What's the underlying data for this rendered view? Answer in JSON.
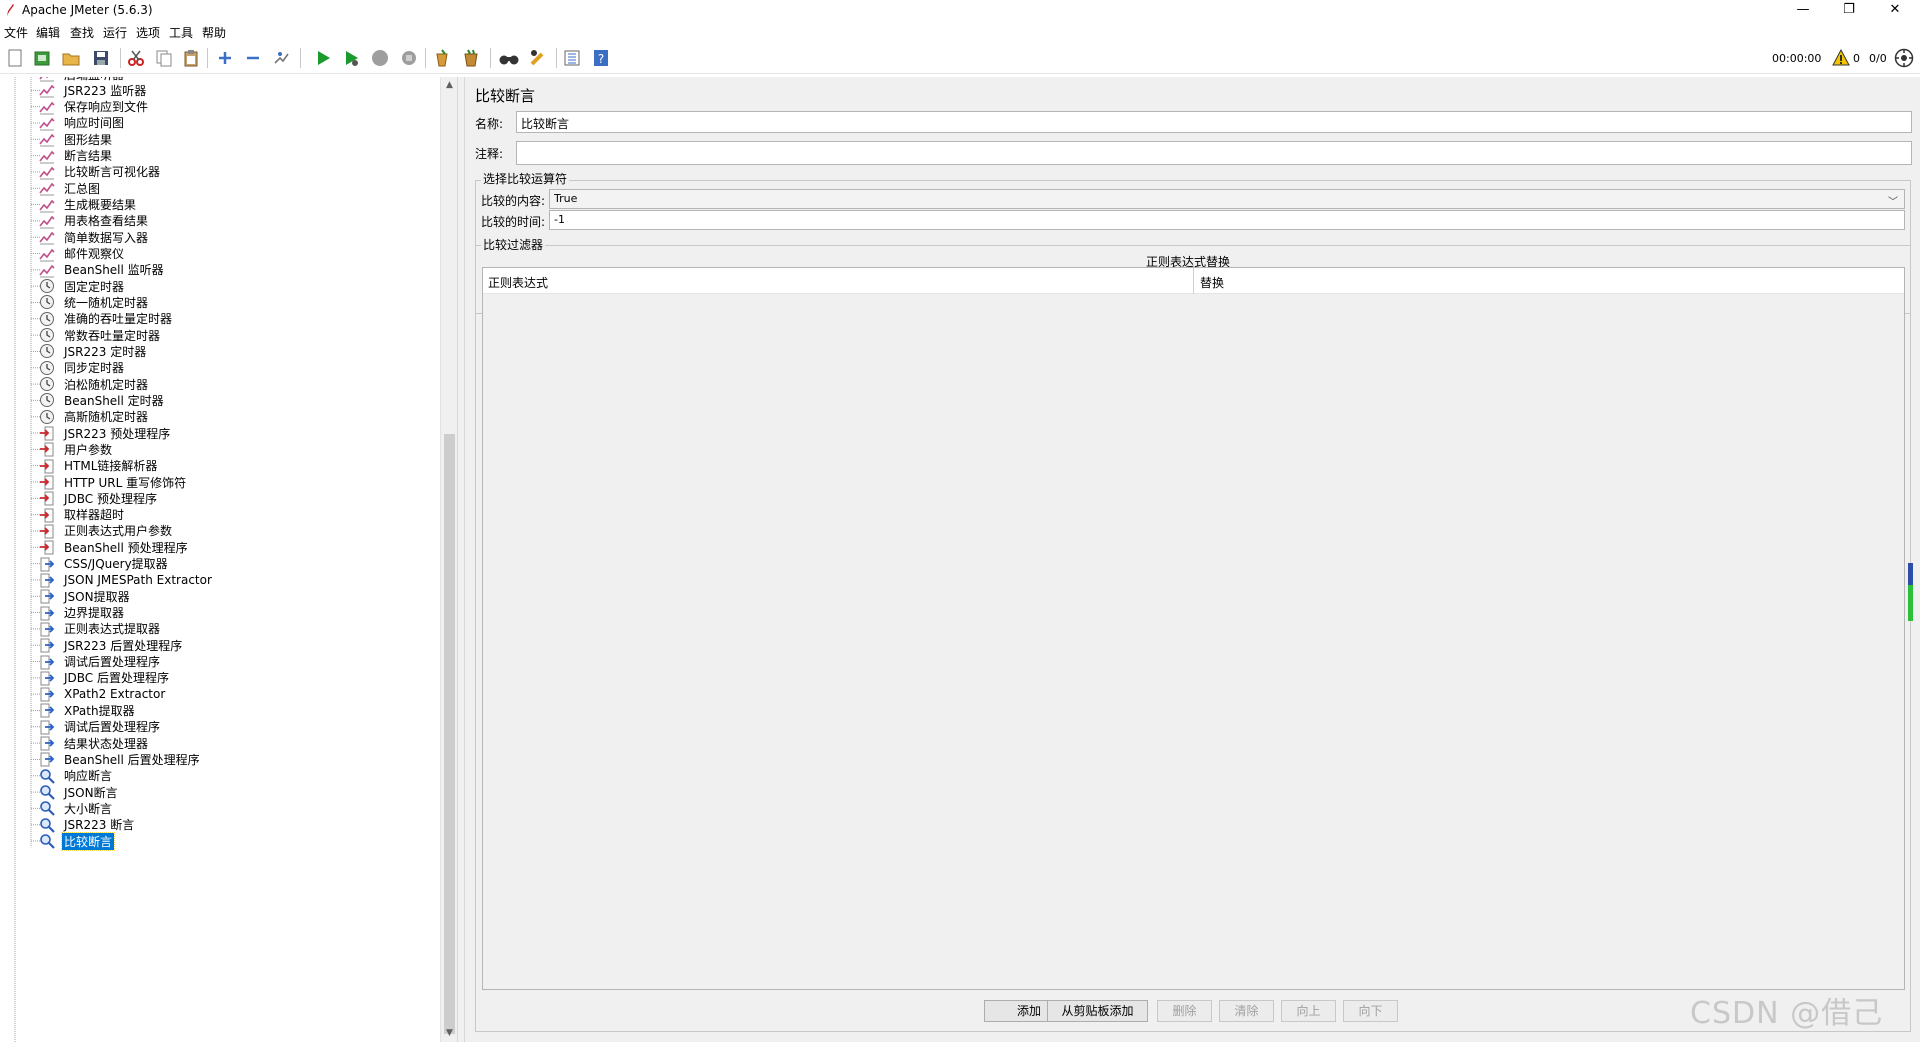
{
  "window": {
    "title": "Apache JMeter (5.6.3)",
    "minimize_symbol": "—",
    "restore_symbol": "❐",
    "close_symbol": "✕"
  },
  "menu": [
    "文件",
    "编辑",
    "查找",
    "运行",
    "选项",
    "工具",
    "帮助"
  ],
  "toolbar": {
    "icons": [
      "new-icon",
      "templates-icon",
      "open-icon",
      "save-icon",
      "cut-icon",
      "copy-icon",
      "paste-icon",
      "expand-icon",
      "collapse-icon",
      "toggle-icon",
      "start-icon",
      "start-no-timers-icon",
      "stop-icon",
      "shutdown-icon",
      "clear-icon",
      "clear-all-icon",
      "search-icon",
      "reset-search-icon",
      "function-helper-icon",
      "help-icon"
    ],
    "timer": "00:00:00",
    "warning_count": "0",
    "thread_count": "0/0"
  },
  "tree": {
    "items": [
      {
        "label": "后端监听器",
        "icon": "listener"
      },
      {
        "label": "JSR223 监听器",
        "icon": "listener"
      },
      {
        "label": "保存响应到文件",
        "icon": "listener"
      },
      {
        "label": "响应时间图",
        "icon": "listener"
      },
      {
        "label": "图形结果",
        "icon": "listener"
      },
      {
        "label": "断言结果",
        "icon": "listener"
      },
      {
        "label": "比较断言可视化器",
        "icon": "listener"
      },
      {
        "label": "汇总图",
        "icon": "listener"
      },
      {
        "label": "生成概要结果",
        "icon": "listener"
      },
      {
        "label": "用表格查看结果",
        "icon": "listener"
      },
      {
        "label": "简单数据写入器",
        "icon": "listener"
      },
      {
        "label": "邮件观察仪",
        "icon": "listener"
      },
      {
        "label": "BeanShell 监听器",
        "icon": "listener"
      },
      {
        "label": "固定定时器",
        "icon": "timer"
      },
      {
        "label": "统一随机定时器",
        "icon": "timer"
      },
      {
        "label": "准确的吞吐量定时器",
        "icon": "timer"
      },
      {
        "label": "常数吞吐量定时器",
        "icon": "timer"
      },
      {
        "label": "JSR223 定时器",
        "icon": "timer"
      },
      {
        "label": "同步定时器",
        "icon": "timer"
      },
      {
        "label": "泊松随机定时器",
        "icon": "timer"
      },
      {
        "label": "BeanShell 定时器",
        "icon": "timer"
      },
      {
        "label": "高斯随机定时器",
        "icon": "timer"
      },
      {
        "label": "JSR223 预处理程序",
        "icon": "preprocessor"
      },
      {
        "label": "用户参数",
        "icon": "preprocessor"
      },
      {
        "label": "HTML链接解析器",
        "icon": "preprocessor"
      },
      {
        "label": "HTTP URL 重写修饰符",
        "icon": "preprocessor"
      },
      {
        "label": "JDBC 预处理程序",
        "icon": "preprocessor"
      },
      {
        "label": "取样器超时",
        "icon": "preprocessor"
      },
      {
        "label": "正则表达式用户参数",
        "icon": "preprocessor"
      },
      {
        "label": "BeanShell 预处理程序",
        "icon": "preprocessor"
      },
      {
        "label": "CSS/JQuery提取器",
        "icon": "postprocessor"
      },
      {
        "label": "JSON JMESPath Extractor",
        "icon": "postprocessor"
      },
      {
        "label": "JSON提取器",
        "icon": "postprocessor"
      },
      {
        "label": "边界提取器",
        "icon": "postprocessor"
      },
      {
        "label": "正则表达式提取器",
        "icon": "postprocessor"
      },
      {
        "label": "JSR223 后置处理程序",
        "icon": "postprocessor"
      },
      {
        "label": "调试后置处理程序",
        "icon": "postprocessor"
      },
      {
        "label": "JDBC 后置处理程序",
        "icon": "postprocessor"
      },
      {
        "label": "XPath2 Extractor",
        "icon": "postprocessor"
      },
      {
        "label": "XPath提取器",
        "icon": "postprocessor"
      },
      {
        "label": "调试后置处理程序",
        "icon": "postprocessor"
      },
      {
        "label": "结果状态处理器",
        "icon": "postprocessor"
      },
      {
        "label": "BeanShell 后置处理程序",
        "icon": "postprocessor"
      },
      {
        "label": "响应断言",
        "icon": "assertion"
      },
      {
        "label": "JSON断言",
        "icon": "assertion"
      },
      {
        "label": "大小断言",
        "icon": "assertion"
      },
      {
        "label": "JSR223 断言",
        "icon": "assertion"
      },
      {
        "label": "比较断言",
        "icon": "assertion",
        "selected": true
      }
    ]
  },
  "panel": {
    "title": "比较断言",
    "name_label": "名称:",
    "name_value": "比较断言",
    "comment_label": "注释:",
    "comment_value": "",
    "compare_group_title": "选择比较运算符",
    "compare_content_label": "比较的内容:",
    "compare_content_value": "True",
    "compare_time_label": "比较的时间:",
    "compare_time_value": "-1",
    "filter_group_title": "比较过滤器",
    "regex_section_title": "正则表达式替换",
    "table_headers": [
      "正则表达式",
      "替换"
    ],
    "buttons": [
      {
        "label": "添加",
        "enabled": true
      },
      {
        "label": "从剪贴板添加",
        "enabled": true
      },
      {
        "label": "删除",
        "enabled": false
      },
      {
        "label": "清除",
        "enabled": false
      },
      {
        "label": "向上",
        "enabled": false
      },
      {
        "label": "向下",
        "enabled": false
      }
    ]
  },
  "watermark": "CSDN @借己"
}
